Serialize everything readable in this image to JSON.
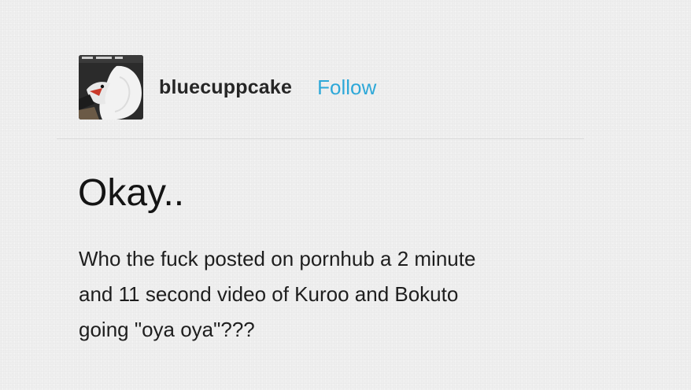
{
  "post": {
    "author": {
      "username": "bluecuppcake",
      "avatar_icon": "bird-avatar-image"
    },
    "follow_label": "Follow",
    "title": "Okay..",
    "body_lines": [
      "Who the fuck posted on pornhub a 2 minute",
      "and 11 second video of Kuroo and Bokuto",
      "going \"oya oya\"???"
    ]
  },
  "colors": {
    "background": "#efefef",
    "follow_link": "#2ea8d8",
    "text": "#1a1a1a"
  }
}
